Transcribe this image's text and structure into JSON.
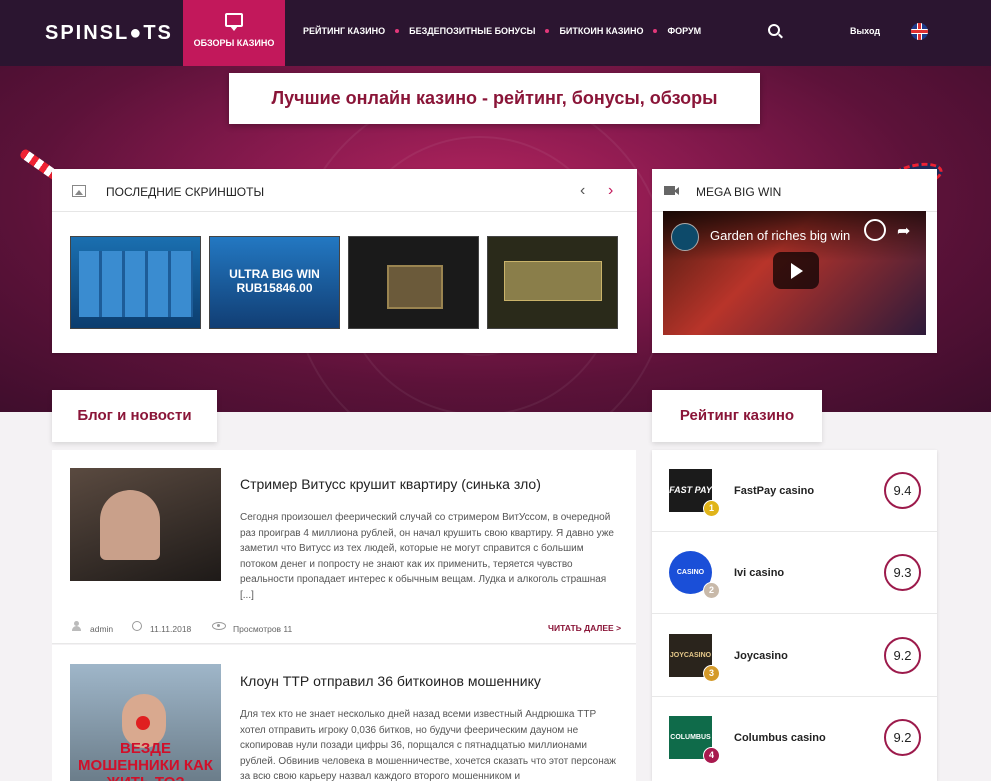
{
  "header": {
    "logo": "SPINSL●TS",
    "nav_active": "ОБЗОРЫ КАЗИНО",
    "menu": [
      "РЕЙТИНГ КАЗИНО",
      "БЕЗДЕПОЗИТНЫЕ БОНУСЫ",
      "БИТКОИН КАЗИНО",
      "ФОРУМ"
    ],
    "logout": "Выход",
    "icons": [
      "message-icon",
      "search-icon",
      "uk-flag-icon"
    ]
  },
  "hero": {
    "title": "Лучшие онлайн казино - рейтинг, бонусы, обзоры"
  },
  "screenshots": {
    "title": "ПОСЛЕДНИЕ СКРИНШОТЫ",
    "prev": "‹",
    "next": "›",
    "thumb_overlay": "ULTRA BIG WIN RUB15846.00"
  },
  "video": {
    "title": "MEGA BIG WIN",
    "video_title": "Garden of riches big win"
  },
  "blog": {
    "section_title": "Блог и новости",
    "posts": [
      {
        "title": "Стример Витусс крушит квартиру (синька зло)",
        "text": "Сегодня произошел феерический случай со стримером ВитУссом, в очередной раз проиграв 4 миллиона рублей, он начал крушить свою квартиру. Я давно уже заметил что Витусс из тех людей, которые не могут справится с большим потоком денег и попросту не знают как их применить, теряется чувство реальности пропадает интерес к обычным вещам. Лудка и алкоголь страшная [...]",
        "author": "admin",
        "date": "11.11.2018",
        "views": "Просмотров 11",
        "read_more": "ЧИТАТЬ ДАЛЕЕ  >"
      },
      {
        "title": "Клоун ТТР отправил 36 биткоинов мошеннику",
        "text": "Для тех кто не знает несколько дней назад всеми известный Андрюшка ТТР хотел отправить игроку 0,036 битков, но будучи феерическим дауном не скопировав нули позади цифры 36, порщался с пятнадцатью миллионами рублей. Обвинив человека в мошенничестве, хочется сказать что этот персонаж за всю свою карьеру назвал каждого второго мошенником и",
        "img_caption": "ВЕЗДЕ МОШЕННИКИ КАК ЖИТЬ ТО?"
      }
    ]
  },
  "rating": {
    "section_title": "Рейтинг казино",
    "items": [
      {
        "rank": "1",
        "name": "FastPay casino",
        "score": "9.4",
        "logo_text": "FAST PAY",
        "badge_color": "#e0b419"
      },
      {
        "rank": "2",
        "name": "Ivi casino",
        "score": "9.3",
        "logo_text": "CASINO",
        "badge_color": "#c8b9a9"
      },
      {
        "rank": "3",
        "name": "Joycasino",
        "score": "9.2",
        "logo_text": "JOYCASINO",
        "badge_color": "#d49a2a"
      },
      {
        "rank": "4",
        "name": "Columbus casino",
        "score": "9.2",
        "logo_text": "COLUMBUS",
        "badge_color": "#a8194e"
      }
    ]
  }
}
